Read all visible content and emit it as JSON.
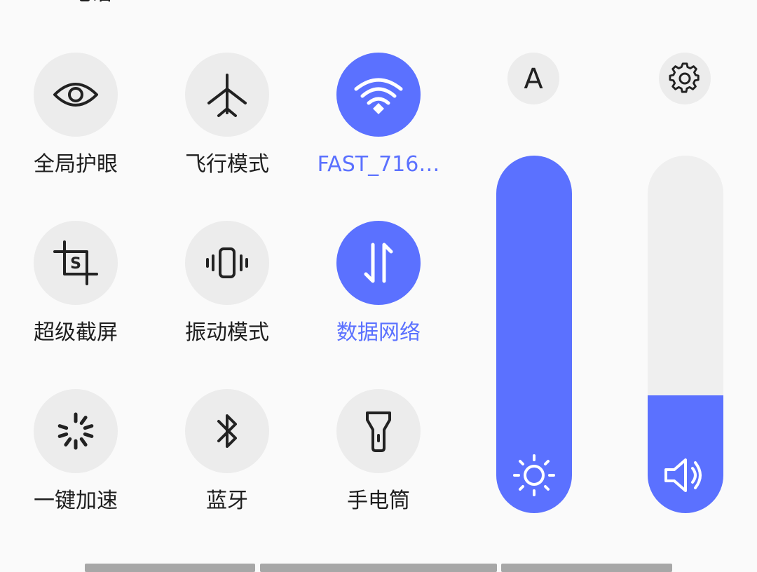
{
  "top_clip_text": "电话",
  "tiles": [
    {
      "label": "全局护眼",
      "icon": "eye-icon",
      "active": false
    },
    {
      "label": "飞行模式",
      "icon": "airplane-icon",
      "active": false
    },
    {
      "label": "FAST_716…",
      "icon": "wifi-icon",
      "active": true
    },
    {
      "label": "超级截屏",
      "icon": "screenshot-icon",
      "active": false
    },
    {
      "label": "振动模式",
      "icon": "vibrate-icon",
      "active": false
    },
    {
      "label": "数据网络",
      "icon": "data-arrows-icon",
      "active": true
    },
    {
      "label": "一键加速",
      "icon": "boost-spinner-icon",
      "active": false
    },
    {
      "label": "蓝牙",
      "icon": "bluetooth-icon",
      "active": false
    },
    {
      "label": "手电筒",
      "icon": "flashlight-icon",
      "active": false
    }
  ],
  "auto_brightness_label": "A",
  "brightness": {
    "icon": "sun-icon",
    "level_percent": 100
  },
  "volume": {
    "icon": "speaker-icon",
    "level_percent": 33
  },
  "settings_icon": "gear-icon",
  "colors": {
    "accent": "#5b71ff",
    "tile_bg": "#ececec",
    "text": "#1e1e1e",
    "background": "#fafafa"
  }
}
